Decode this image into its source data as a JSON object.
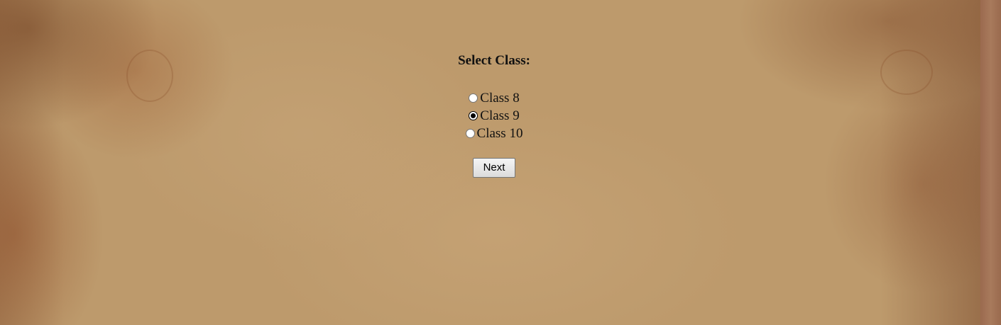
{
  "form": {
    "title": "Select Class:",
    "options": [
      {
        "label": "Class 8",
        "checked": false
      },
      {
        "label": "Class 9",
        "checked": true
      },
      {
        "label": "Class 10",
        "checked": false
      }
    ],
    "next_label": "Next"
  },
  "colors": {
    "background": "#bd9a6c",
    "text": "#111111",
    "button_bg": "#e9e9e9"
  }
}
